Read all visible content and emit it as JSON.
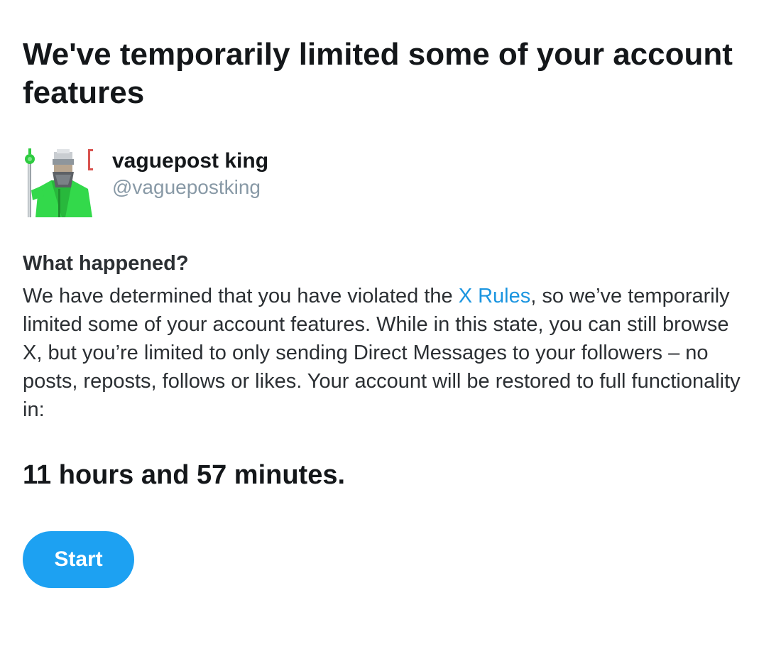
{
  "page": {
    "title": "We've temporarily limited some of your account features"
  },
  "account": {
    "display_name": "vaguepost king",
    "handle": "@vaguepostking",
    "avatar_icon": "pixel-art-green-robed-figure-with-staff-avatar"
  },
  "notice": {
    "heading": "What happened?",
    "text_before_link": "We have determined that you have violated the ",
    "link_label": "X Rules",
    "text_after_link": ", so we’ve temporarily limited some of your account features. While in this state, you can still browse X, but you’re limited to only sending Direct Messages to your followers – no posts, reposts, follows or likes. Your account will be restored to full functionality in:"
  },
  "countdown": {
    "text": "11 hours and 57 minutes."
  },
  "actions": {
    "start_label": "Start"
  },
  "colors": {
    "link": "#1b95e0",
    "button": "#1da1f2",
    "handle": "#8899a6"
  }
}
